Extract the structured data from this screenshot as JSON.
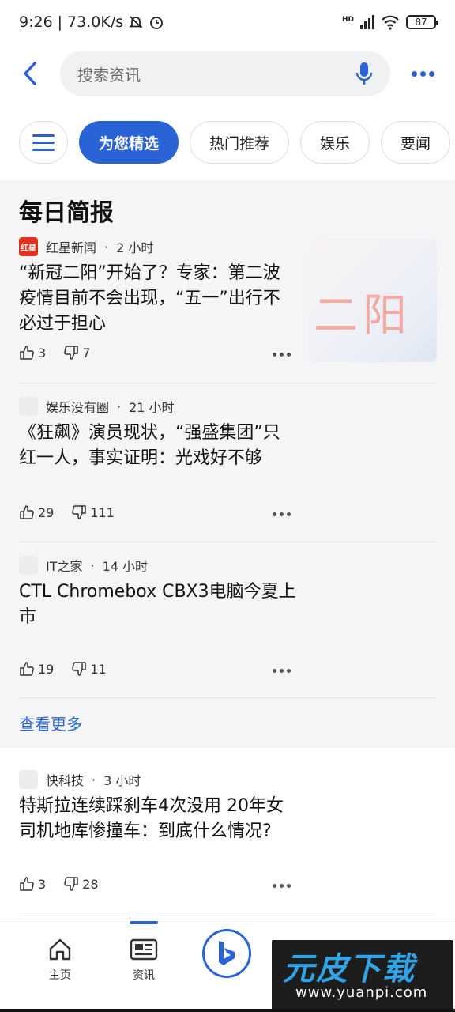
{
  "status_bar": {
    "time": "9:26",
    "speed": "73.0K/s",
    "network": "HD",
    "battery": "87"
  },
  "search": {
    "placeholder": "搜索资讯"
  },
  "tabs": [
    "为您精选",
    "热门推荐",
    "娱乐",
    "要闻"
  ],
  "brief": {
    "title": "每日简报",
    "see_more": "查看更多",
    "items": [
      {
        "source": "红星新闻",
        "source_logo": "红星",
        "time": "2 小时",
        "headline": "“新冠二阳”开始了？专家：第二波疫情目前不会出现，“五一”出行不必过于担心",
        "likes": "3",
        "dislikes": "7",
        "thumb_text": "二阳"
      },
      {
        "source": "娱乐没有圈",
        "time": "21 小时",
        "headline": "《狂飙》演员现状，“强盛集团”只红一人，事实证明：光戏好不够",
        "likes": "29",
        "dislikes": "111"
      },
      {
        "source": "IT之家",
        "time": "14 小时",
        "headline": "CTL Chromebox CBX3电脑今夏上市",
        "likes": "19",
        "dislikes": "11"
      }
    ]
  },
  "feed": {
    "items": [
      {
        "source": "快科技",
        "time": "3 小时",
        "headline": "特斯拉连续踩刹车4次没用 20年女司机地库惨撞车：到底什么情况?",
        "likes": "3",
        "dislikes": "28"
      }
    ]
  },
  "bottom_nav": {
    "home": "主页",
    "news": "资讯"
  },
  "watermark": {
    "brand": "元皮下载",
    "url": "www.yuanpi.com"
  },
  "colors": {
    "accent": "#2a63d6",
    "section_bg": "#f5f5f7"
  }
}
